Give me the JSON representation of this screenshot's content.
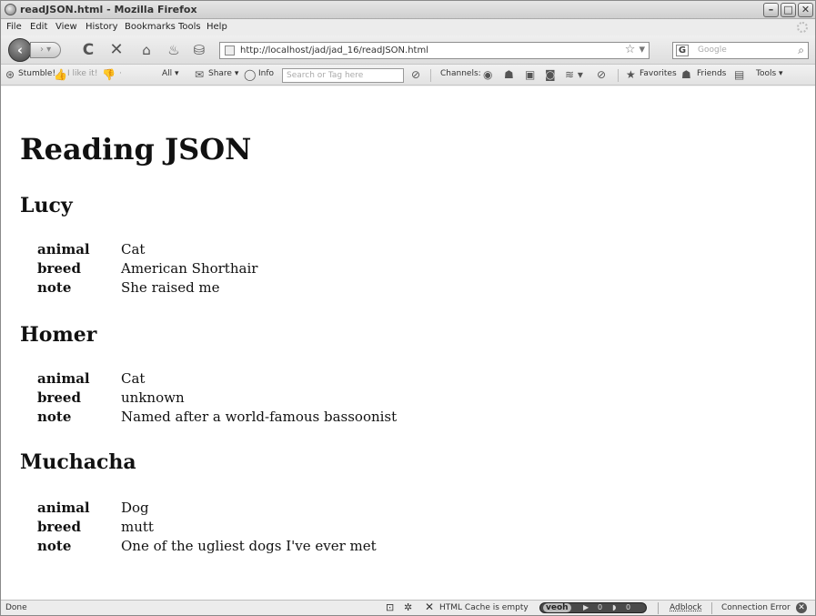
{
  "window": {
    "title": "readJSON.html - Mozilla Firefox",
    "minimize": "–",
    "maximize": "□",
    "close": "✕"
  },
  "menu": [
    "File",
    "Edit",
    "View",
    "History",
    "Bookmarks",
    "Tools",
    "Help"
  ],
  "nav": {
    "url": "http://localhost/jad/jad_16/readJSON.html",
    "search_engine_label": "G",
    "search_placeholder": "Google"
  },
  "stumble_toolbar": {
    "stumble": "Stumble!",
    "like": "I like it!",
    "all": "All ▾",
    "share": "Share ▾",
    "info": "Info",
    "search_placeholder": "Search or Tag here",
    "channels": "Channels:",
    "favorites": "Favorites",
    "friends": "Friends",
    "tools": "Tools ▾"
  },
  "page": {
    "heading": "Reading JSON",
    "pets": [
      {
        "name": "Lucy",
        "fields": [
          {
            "key": "animal",
            "value": "Cat"
          },
          {
            "key": "breed",
            "value": "American Shorthair"
          },
          {
            "key": "note",
            "value": "She raised me"
          }
        ]
      },
      {
        "name": "Homer",
        "fields": [
          {
            "key": "animal",
            "value": "Cat"
          },
          {
            "key": "breed",
            "value": "unknown"
          },
          {
            "key": "note",
            "value": "Named after a world-famous bassoonist"
          }
        ]
      },
      {
        "name": "Muchacha",
        "fields": [
          {
            "key": "animal",
            "value": "Dog"
          },
          {
            "key": "breed",
            "value": "mutt"
          },
          {
            "key": "note",
            "value": "One of the ugliest dogs I've ever met"
          }
        ]
      }
    ]
  },
  "status": {
    "text": "Done",
    "cache": "HTML Cache is empty",
    "veoh": "veoh",
    "veoh_count_1": "0",
    "veoh_count_2": "0",
    "adblock": "Adblock",
    "connection": "Connection Error"
  }
}
